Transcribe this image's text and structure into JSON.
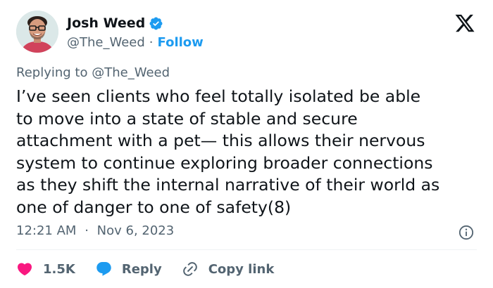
{
  "author": {
    "name": "Josh Weed",
    "handle": "@The_Weed",
    "separator": "·",
    "follow_label": "Follow",
    "verified_color": "#1d9bf0"
  },
  "brand": {
    "logo_icon": "x-logo-icon"
  },
  "replying": {
    "prefix": "Replying to",
    "handle": "@The_Weed"
  },
  "tweet": {
    "text_lines": [
      "I’ve seen clients who feel totally isolated be able",
      "to move into a state of stable and secure",
      "attachment with a pet— this allows their nervous",
      "system to continue exploring broader connections",
      "as they shift the internal narrative of their world as",
      "one of danger to one of safety(8)"
    ],
    "time": "12:21 AM",
    "separator": "·",
    "date": "Nov 6, 2023"
  },
  "actions": {
    "like_count": "1.5K",
    "reply_label": "Reply",
    "copy_label": "Copy link",
    "like_color": "#f91880",
    "reply_color": "#1d9bf0"
  }
}
